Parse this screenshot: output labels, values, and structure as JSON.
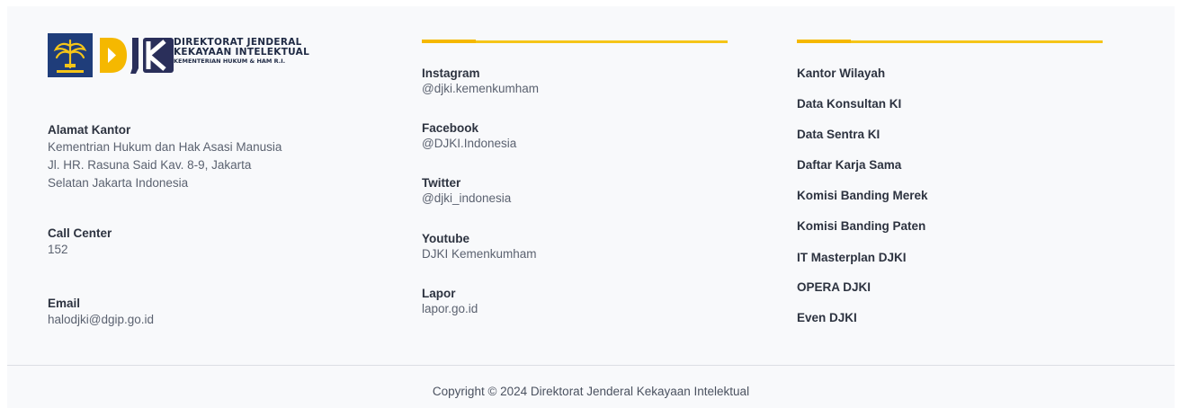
{
  "logo": {
    "line1": "DIREKTORAT JENDERAL",
    "line2": "KEKAYAAN INTELEKTUAL",
    "line3": "KEMENTERIAN HUKUM & HAM R.I."
  },
  "contact": {
    "address_label": "Alamat Kantor",
    "address_lines": [
      "Kementrian Hukum dan Hak Asasi Manusia",
      "Jl. HR. Rasuna Said Kav. 8-9, Jakarta",
      "Selatan Jakarta Indonesia"
    ],
    "call_label": "Call Center",
    "call_value": "152",
    "email_label": "Email",
    "email_value": "halodjki@dgip.go.id"
  },
  "social": [
    {
      "label": "Instagram",
      "value": "@djki.kemenkumham"
    },
    {
      "label": "Facebook",
      "value": "@DJKI.Indonesia"
    },
    {
      "label": "Twitter",
      "value": "@djki_indonesia"
    },
    {
      "label": "Youtube",
      "value": "DJKI Kemenkumham"
    },
    {
      "label": "Lapor",
      "value": "lapor.go.id"
    }
  ],
  "links": [
    "Kantor Wilayah",
    "Data Konsultan KI",
    "Data Sentra KI",
    "Daftar Karja Sama",
    "Komisi Banding Merek",
    "Komisi Banding Paten",
    "IT Masterplan DJKI",
    "OPERA DJKI",
    "Even DJKI"
  ],
  "copyright": "Copyright © 2024 Direktorat Jenderal Kekayaan Intelektual",
  "colors": {
    "accent": "#f5c518",
    "brand_navy": "#1f3d7a",
    "background": "#f8f9fb"
  }
}
